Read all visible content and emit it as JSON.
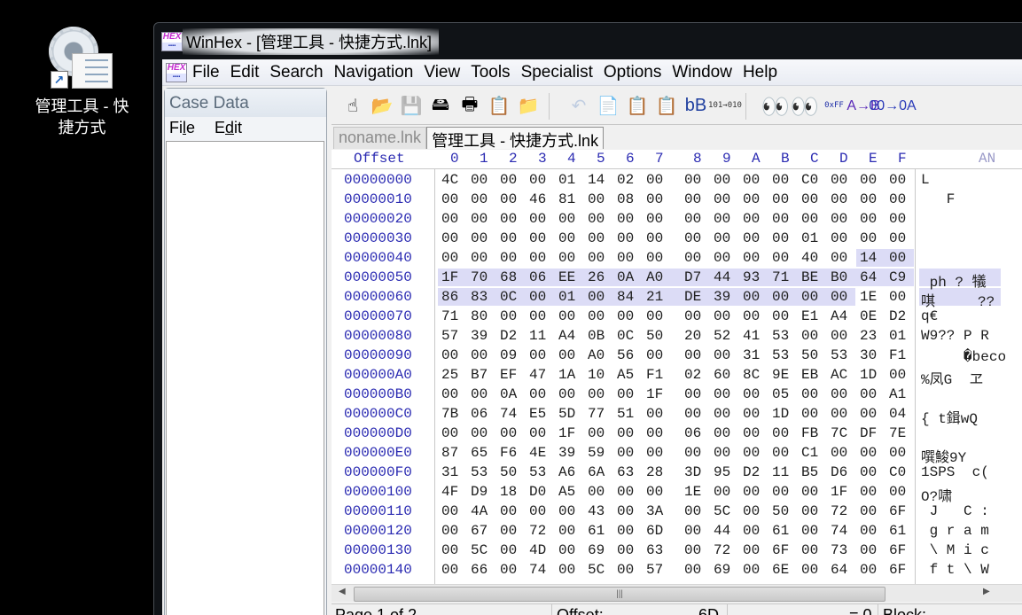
{
  "desktop": {
    "icon_label_line1": "管理工具 - 快",
    "icon_label_line2": "捷方式"
  },
  "window": {
    "title": "WinHex - [管理工具 - 快捷方式.lnk]",
    "logo_text": "HEX",
    "logo_sub": "ज़ाउसहडि"
  },
  "menu": [
    "File",
    "Edit",
    "Search",
    "Navigation",
    "View",
    "Tools",
    "Specialist",
    "Options",
    "Window",
    "Help"
  ],
  "case_data": {
    "title": "Case Data",
    "menu_file": "File",
    "menu_edit": "Edit"
  },
  "toolbar": [
    {
      "name": "new-file-icon",
      "glyph": "☝",
      "enabled": true
    },
    {
      "name": "open-file-icon",
      "glyph": "📂",
      "enabled": true
    },
    {
      "name": "save-icon",
      "glyph": "💾",
      "enabled": false
    },
    {
      "name": "open-disk-icon",
      "glyph": "🖴",
      "enabled": true
    },
    {
      "name": "print-icon",
      "glyph": "🖶",
      "enabled": true
    },
    {
      "name": "properties-icon",
      "glyph": "📋",
      "enabled": true
    },
    {
      "name": "run-icon",
      "glyph": "📁",
      "enabled": true
    },
    {
      "name": "undo-icon",
      "glyph": "↶",
      "enabled": false
    },
    {
      "name": "copy-icon",
      "glyph": "📄",
      "enabled": true
    },
    {
      "name": "paste-icon",
      "glyph": "📋",
      "enabled": true
    },
    {
      "name": "paste-into-icon",
      "glyph": "📋",
      "enabled": true
    },
    {
      "name": "write-clipboard-icon",
      "glyph": "bB",
      "enabled": true
    },
    {
      "name": "binary-convert-icon",
      "glyph": "101→010",
      "enabled": true
    },
    {
      "name": "find-text-icon",
      "glyph": "👀",
      "enabled": true
    },
    {
      "name": "find-hex-icon",
      "glyph": "👀",
      "enabled": true
    },
    {
      "name": "find-hex-values-icon",
      "glyph": "0xFF",
      "enabled": true
    },
    {
      "name": "replace-text-icon",
      "glyph": "A→B",
      "enabled": true
    },
    {
      "name": "replace-hex-icon",
      "glyph": "00→0A",
      "enabled": true
    }
  ],
  "tabs": [
    {
      "label": "noname.lnk",
      "active": false
    },
    {
      "label": "管理工具 - 快捷方式.lnk",
      "active": true
    }
  ],
  "hex": {
    "offset_header": "Offset",
    "columns": [
      "0",
      "1",
      "2",
      "3",
      "4",
      "5",
      "6",
      "7",
      "8",
      "9",
      "A",
      "B",
      "C",
      "D",
      "E",
      "F"
    ],
    "text_header": "AN",
    "rows": [
      {
        "offset": "00000000",
        "bytes": [
          "4C",
          "00",
          "00",
          "00",
          "01",
          "14",
          "02",
          "00",
          "00",
          "00",
          "00",
          "00",
          "C0",
          "00",
          "00",
          "00"
        ],
        "text": "L"
      },
      {
        "offset": "00000010",
        "bytes": [
          "00",
          "00",
          "00",
          "46",
          "81",
          "00",
          "08",
          "00",
          "00",
          "00",
          "00",
          "00",
          "00",
          "00",
          "00",
          "00"
        ],
        "text": "   F"
      },
      {
        "offset": "00000020",
        "bytes": [
          "00",
          "00",
          "00",
          "00",
          "00",
          "00",
          "00",
          "00",
          "00",
          "00",
          "00",
          "00",
          "00",
          "00",
          "00",
          "00"
        ],
        "text": ""
      },
      {
        "offset": "00000030",
        "bytes": [
          "00",
          "00",
          "00",
          "00",
          "00",
          "00",
          "00",
          "00",
          "00",
          "00",
          "00",
          "00",
          "01",
          "00",
          "00",
          "00"
        ],
        "text": ""
      },
      {
        "offset": "00000040",
        "bytes": [
          "00",
          "00",
          "00",
          "00",
          "00",
          "00",
          "00",
          "00",
          "00",
          "00",
          "00",
          "00",
          "40",
          "00",
          "14",
          "00"
        ],
        "text": ""
      },
      {
        "offset": "00000050",
        "bytes": [
          "1F",
          "70",
          "68",
          "06",
          "EE",
          "26",
          "0A",
          "A0",
          "D7",
          "44",
          "93",
          "71",
          "BE",
          "B0",
          "64",
          "C9"
        ],
        "text": " ph ? 犠"
      },
      {
        "offset": "00000060",
        "bytes": [
          "86",
          "83",
          "0C",
          "00",
          "01",
          "00",
          "84",
          "21",
          "DE",
          "39",
          "00",
          "00",
          "00",
          "00",
          "1E",
          "00"
        ],
        "text": "唭     ??"
      },
      {
        "offset": "00000070",
        "bytes": [
          "71",
          "80",
          "00",
          "00",
          "00",
          "00",
          "00",
          "00",
          "00",
          "00",
          "00",
          "00",
          "E1",
          "A4",
          "0E",
          "D2"
        ],
        "text": "q€"
      },
      {
        "offset": "00000080",
        "bytes": [
          "57",
          "39",
          "D2",
          "11",
          "A4",
          "0B",
          "0C",
          "50",
          "20",
          "52",
          "41",
          "53",
          "00",
          "00",
          "23",
          "01"
        ],
        "text": "W9?? P R"
      },
      {
        "offset": "00000090",
        "bytes": [
          "00",
          "00",
          "09",
          "00",
          "00",
          "A0",
          "56",
          "00",
          "00",
          "00",
          "31",
          "53",
          "50",
          "53",
          "30",
          "F1"
        ],
        "text": "     �becomes"
      },
      {
        "offset": "000000A0",
        "bytes": [
          "25",
          "B7",
          "EF",
          "47",
          "1A",
          "10",
          "A5",
          "F1",
          "02",
          "60",
          "8C",
          "9E",
          "EB",
          "AC",
          "1D",
          "00"
        ],
        "text": "%凤G  ヱ"
      },
      {
        "offset": "000000B0",
        "bytes": [
          "00",
          "00",
          "0A",
          "00",
          "00",
          "00",
          "00",
          "1F",
          "00",
          "00",
          "00",
          "05",
          "00",
          "00",
          "00",
          "A1"
        ],
        "text": ""
      },
      {
        "offset": "000000C0",
        "bytes": [
          "7B",
          "06",
          "74",
          "E5",
          "5D",
          "77",
          "51",
          "00",
          "00",
          "00",
          "00",
          "1D",
          "00",
          "00",
          "00",
          "04"
        ],
        "text": "{ t鍓wQ"
      },
      {
        "offset": "000000D0",
        "bytes": [
          "00",
          "00",
          "00",
          "00",
          "1F",
          "00",
          "00",
          "00",
          "06",
          "00",
          "00",
          "00",
          "FB",
          "7C",
          "DF",
          "7E"
        ],
        "text": ""
      },
      {
        "offset": "000000E0",
        "bytes": [
          "87",
          "65",
          "F6",
          "4E",
          "39",
          "59",
          "00",
          "00",
          "00",
          "00",
          "00",
          "00",
          "C1",
          "00",
          "00",
          "00"
        ],
        "text": "噀鮻9Y"
      },
      {
        "offset": "000000F0",
        "bytes": [
          "31",
          "53",
          "50",
          "53",
          "A6",
          "6A",
          "63",
          "28",
          "3D",
          "95",
          "D2",
          "11",
          "B5",
          "D6",
          "00",
          "C0"
        ],
        "text": "1SPS  c("
      },
      {
        "offset": "00000100",
        "bytes": [
          "4F",
          "D9",
          "18",
          "D0",
          "A5",
          "00",
          "00",
          "00",
          "1E",
          "00",
          "00",
          "00",
          "00",
          "1F",
          "00",
          "00"
        ],
        "text": "O?啸"
      },
      {
        "offset": "00000110",
        "bytes": [
          "00",
          "4A",
          "00",
          "00",
          "00",
          "43",
          "00",
          "3A",
          "00",
          "5C",
          "00",
          "50",
          "00",
          "72",
          "00",
          "6F"
        ],
        "text": " J   C :"
      },
      {
        "offset": "00000120",
        "bytes": [
          "00",
          "67",
          "00",
          "72",
          "00",
          "61",
          "00",
          "6D",
          "00",
          "44",
          "00",
          "61",
          "00",
          "74",
          "00",
          "61"
        ],
        "text": " g r a m"
      },
      {
        "offset": "00000130",
        "bytes": [
          "00",
          "5C",
          "00",
          "4D",
          "00",
          "69",
          "00",
          "63",
          "00",
          "72",
          "00",
          "6F",
          "00",
          "73",
          "00",
          "6F"
        ],
        "text": " \\ M i c"
      },
      {
        "offset": "00000140",
        "bytes": [
          "00",
          "66",
          "00",
          "74",
          "00",
          "5C",
          "00",
          "57",
          "00",
          "69",
          "00",
          "6E",
          "00",
          "64",
          "00",
          "6F"
        ],
        "text": " f t \\ W"
      }
    ]
  },
  "status": {
    "page": "Page 1 of 2",
    "offset_label": "Offset:",
    "offset_value": "6D",
    "value": "= 0",
    "block_label": "Block:"
  }
}
